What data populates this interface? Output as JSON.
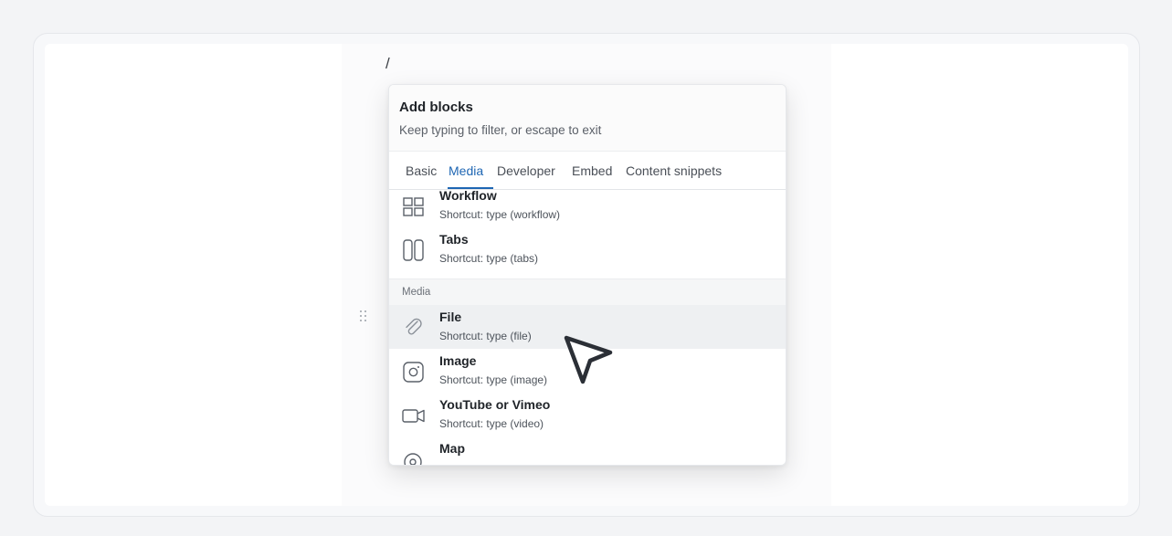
{
  "editor": {
    "typed_text": "/"
  },
  "menu": {
    "title": "Add blocks",
    "subtitle": "Keep typing to filter, or escape to exit",
    "tabs": [
      {
        "label": "Basic",
        "active": false
      },
      {
        "label": "Media",
        "active": true
      },
      {
        "label": "Developer",
        "active": false
      },
      {
        "label": "Embed",
        "active": false
      },
      {
        "label": "Content snippets",
        "active": false
      }
    ],
    "section_label": "Media",
    "items": [
      {
        "label": "Workflow",
        "shortcut": "Shortcut: type (workflow)",
        "icon": "grid-icon"
      },
      {
        "label": "Tabs",
        "shortcut": "Shortcut: type (tabs)",
        "icon": "tabs-icon"
      },
      {
        "label": "File",
        "shortcut": "Shortcut: type (file)",
        "icon": "paperclip-icon"
      },
      {
        "label": "Image",
        "shortcut": "Shortcut: type (image)",
        "icon": "image-icon"
      },
      {
        "label": "YouTube or Vimeo",
        "shortcut": "Shortcut: type (video)",
        "icon": "video-icon"
      },
      {
        "label": "Map",
        "shortcut": "",
        "icon": "map-pin-icon"
      }
    ]
  },
  "colors": {
    "accent": "#1e66b3",
    "hover_row": "#eef0f2",
    "cursor": "#2b2f36"
  }
}
